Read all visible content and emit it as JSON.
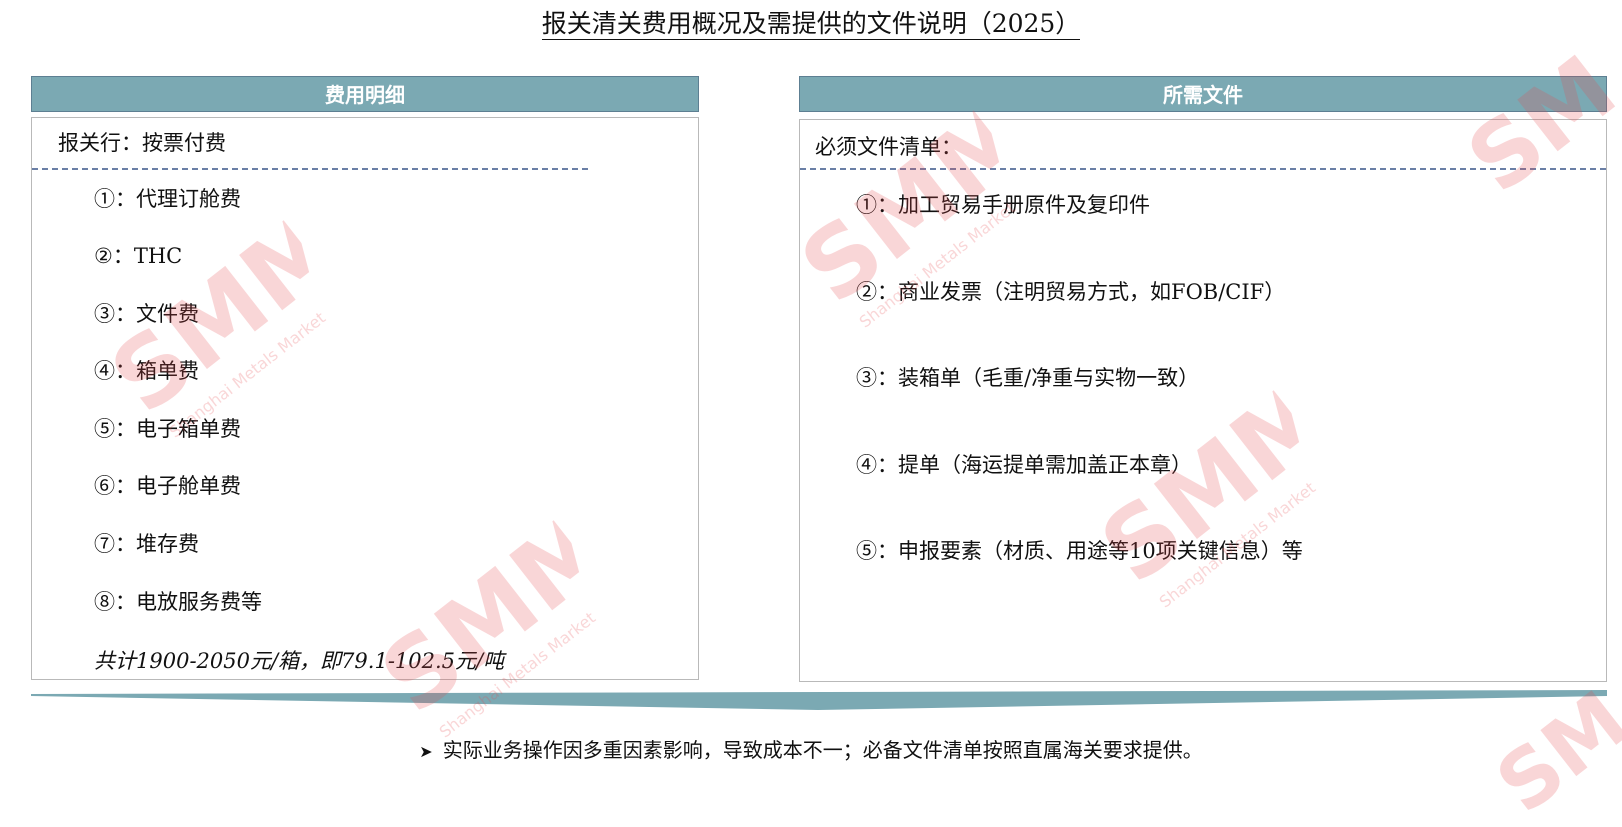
{
  "title": "报关清关费用概况及需提供的文件说明（2025）",
  "left": {
    "header": "费用明细",
    "subheading": "报关行：按票付费",
    "items": [
      "①：代理订舱费",
      "②：THC",
      "③：文件费",
      "④：箱单费",
      "⑤：电子箱单费",
      "⑥：电子舱单费",
      "⑦：堆存费",
      "⑧：电放服务费等"
    ],
    "total": "共计1900-2050元/箱，即79.1-102.5元/吨"
  },
  "right": {
    "header": "所需文件",
    "subheading": "必须文件清单：",
    "items": [
      "①：加工贸易手册原件及复印件",
      "②：商业发票（注明贸易方式，如FOB/CIF）",
      "③：装箱单（毛重/净重与实物一致）",
      "④：提单（海运提单需加盖正本章）",
      "⑤：申报要素（材质、用途等10项关键信息）等"
    ]
  },
  "note": {
    "bullet_icon": "arrow-bullet-icon",
    "text": "实际业务操作因多重因素影响，导致成本不一；必备文件清单按照直属海关要求提供。"
  },
  "watermark": {
    "logo_text": "SMM",
    "tagline": "Shanghai Metals Market",
    "color": "#e8494f"
  },
  "colors": {
    "header_bg": "#7ba9b3",
    "divider": "#7ba9b3",
    "dash": "#6a7fa6"
  }
}
